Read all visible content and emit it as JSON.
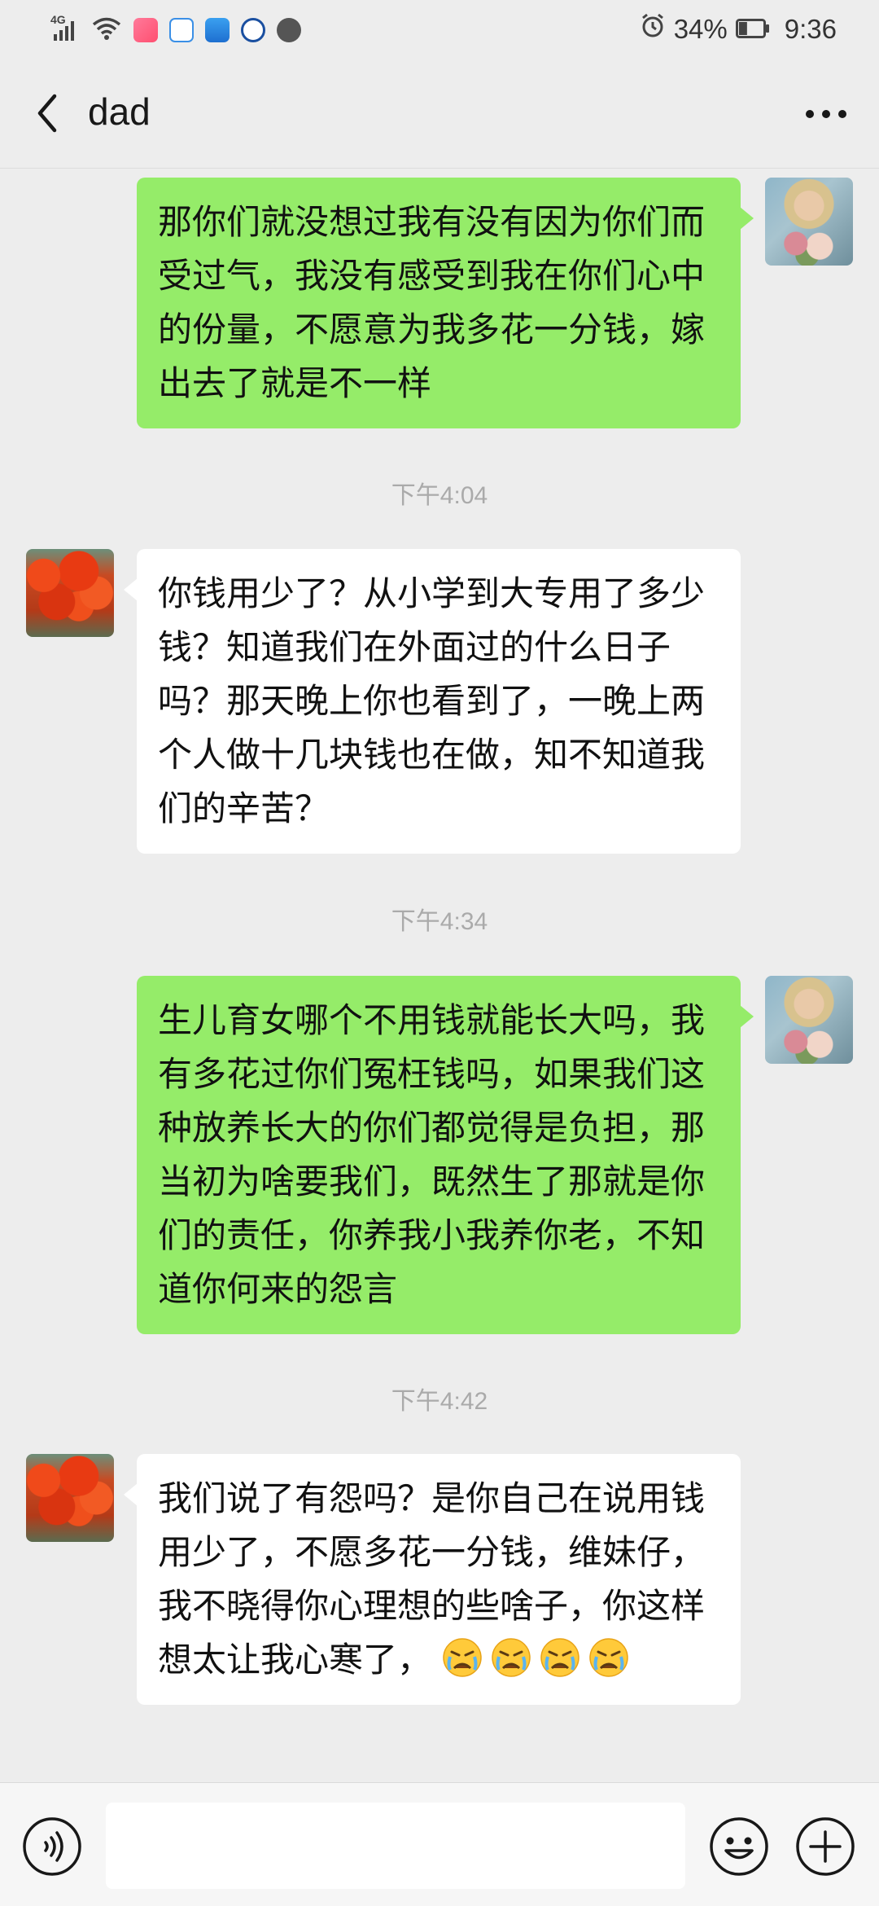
{
  "status_bar": {
    "network": "4G",
    "battery_percent": "34%",
    "time": "9:36",
    "battery_level": 0.34,
    "icons": [
      "signal-icon",
      "wifi-icon",
      "app-notification-icon",
      "chat-bubble-icon",
      "wallet-icon",
      "browser-icon",
      "send-icon",
      "alarm-icon",
      "battery-icon"
    ]
  },
  "header": {
    "title": "dad",
    "back_icon": "chevron-left-icon",
    "more_icon": "more-dots-icon"
  },
  "messages": [
    {
      "sender": "me",
      "text": "那你们就没想过我有没有因为你们而受过气，我没有感受到我在你们心中的份量，不愿意为我多花一分钱，嫁出去了就是不一样"
    },
    {
      "type": "time",
      "text": "下午4:04"
    },
    {
      "sender": "dad",
      "text": "你钱用少了？从小学到大专用了多少钱？知道我们在外面过的什么日子吗？那天晚上你也看到了，一晚上两个人做十几块钱也在做，知不知道我们的辛苦？"
    },
    {
      "type": "time",
      "text": "下午4:34"
    },
    {
      "sender": "me",
      "text": "生儿育女哪个不用钱就能长大吗，我有多花过你们冤枉钱吗，如果我们这种放养长大的你们都觉得是负担，那当初为啥要我们，既然生了那就是你们的责任，你养我小我养你老，不知道你何来的怨言"
    },
    {
      "type": "time",
      "text": "下午4:42"
    },
    {
      "sender": "dad",
      "text": "我们说了有怨吗？是你自己在说用钱用少了，不愿多花一分钱，维妹仔，我不晓得你心理想的些啥子，你这样想太让我心寒了，",
      "emojis": [
        "crying-face-emoji",
        "crying-face-emoji",
        "crying-face-emoji",
        "crying-face-emoji"
      ]
    }
  ],
  "input_bar": {
    "voice_icon": "voice-icon",
    "input_value": "",
    "emoji_icon": "emoji-icon",
    "plus_icon": "plus-icon"
  },
  "colors": {
    "background": "#ededed",
    "my_bubble": "#95ec69",
    "their_bubble": "#ffffff",
    "timestamp": "#aaaaaa"
  }
}
